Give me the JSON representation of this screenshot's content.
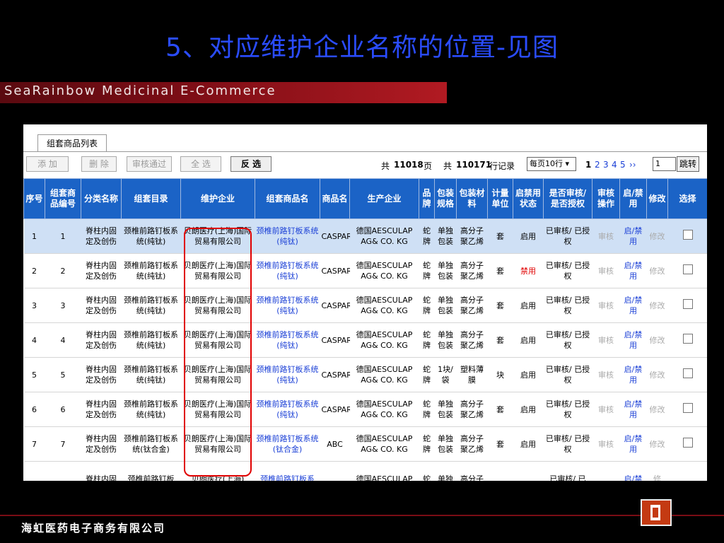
{
  "slide": {
    "title": "5、对应维护企业名称的位置-见图",
    "brand": "SeaRainbow Medicinal E-Commerce",
    "footer": "海虹医药电子商务有限公司"
  },
  "panel": {
    "tab": "组套商品列表",
    "toolbar": {
      "add": "添 加",
      "delete": "删 除",
      "approve": "审核通过",
      "select_all": "全 选",
      "invert": "反 选",
      "total_pages_prefix": "共",
      "total_pages": "11018",
      "pages_unit": "页",
      "total_rows_prefix": "共",
      "total_rows": "110171",
      "rows_unit": "行记录",
      "page_size": "每页10行",
      "pages": [
        "1",
        "2",
        "3",
        "4",
        "5"
      ],
      "next": "››",
      "page_input": "1",
      "jump": "跳转"
    },
    "columns": [
      "序号",
      "组套商品编号",
      "分类名称",
      "组套目录",
      "维护企业",
      "组套商品名",
      "商品名",
      "生产企业",
      "品牌",
      "包装规格",
      "包装材料",
      "计量单位",
      "启禁用状态",
      "是否审核/是否授权",
      "审核操作",
      "启/禁用",
      "修改",
      "选择"
    ],
    "rows": [
      [
        "1",
        "1",
        "脊柱内固定及创伤",
        "颈椎前路钉板系统(纯钛)",
        "贝朗医疗(上海)国际贸易有限公司",
        "颈椎前路钉板系统(纯钛)",
        "CASPAR",
        "德国AESCULAP AG& CO. KG",
        "蛇牌",
        "单独包装",
        "高分子聚乙烯",
        "套",
        "启用",
        "已审核/ 已授权",
        "审核",
        "启/禁用",
        "修改"
      ],
      [
        "2",
        "2",
        "脊柱内固定及创伤",
        "颈椎前路钉板系统(纯钛)",
        "贝朗医疗(上海)国际贸易有限公司",
        "颈椎前路钉板系统(纯钛)",
        "CASPAR",
        "德国AESCULAP AG& CO. KG",
        "蛇牌",
        "单独包装",
        "高分子聚乙烯",
        "套",
        "禁用",
        "已审核/ 已授权",
        "审核",
        "启/禁用",
        "修改"
      ],
      [
        "3",
        "3",
        "脊柱内固定及创伤",
        "颈椎前路钉板系统(纯钛)",
        "贝朗医疗(上海)国际贸易有限公司",
        "颈椎前路钉板系统(纯钛)",
        "CASPAR",
        "德国AESCULAP AG& CO. KG",
        "蛇牌",
        "单独包装",
        "高分子聚乙烯",
        "套",
        "启用",
        "已审核/ 已授权",
        "审核",
        "启/禁用",
        "修改"
      ],
      [
        "4",
        "4",
        "脊柱内固定及创伤",
        "颈椎前路钉板系统(纯钛)",
        "贝朗医疗(上海)国际贸易有限公司",
        "颈椎前路钉板系统(纯钛)",
        "CASPAR",
        "德国AESCULAP AG& CO. KG",
        "蛇牌",
        "单独包装",
        "高分子聚乙烯",
        "套",
        "启用",
        "已审核/ 已授权",
        "审核",
        "启/禁用",
        "修改"
      ],
      [
        "5",
        "5",
        "脊柱内固定及创伤",
        "颈椎前路钉板系统(纯钛)",
        "贝朗医疗(上海)国际贸易有限公司",
        "颈椎前路钉板系统(纯钛)",
        "CASPAR",
        "德国AESCULAP AG& CO. KG",
        "蛇牌",
        "1块/袋",
        "塑料薄膜",
        "块",
        "启用",
        "已审核/ 已授权",
        "审核",
        "启/禁用",
        "修改"
      ],
      [
        "6",
        "6",
        "脊柱内固定及创伤",
        "颈椎前路钉板系统(纯钛)",
        "贝朗医疗(上海)国际贸易有限公司",
        "颈椎前路钉板系统(纯钛)",
        "CASPAR",
        "德国AESCULAP AG& CO. KG",
        "蛇牌",
        "单独包装",
        "高分子聚乙烯",
        "套",
        "启用",
        "已审核/ 已授权",
        "审核",
        "启/禁用",
        "修改"
      ],
      [
        "7",
        "7",
        "脊柱内固定及创伤",
        "颈椎前路钉板系统(钛合金)",
        "贝朗医疗(上海)国际贸易有限公司",
        "颈椎前路钉板系统(钛合金)",
        "ABC",
        "德国AESCULAP AG& CO. KG",
        "蛇牌",
        "单独包装",
        "高分子聚乙烯",
        "套",
        "启用",
        "已审核/ 已授权",
        "审核",
        "启/禁用",
        "修改"
      ],
      [
        "",
        "",
        "脊柱内固",
        "颈椎前路钉板",
        "贝朗医疗(上海)",
        "颈椎前路钉板系",
        "",
        "德国AESCULAP",
        "蛇",
        "单独",
        "高分子",
        "",
        "",
        "已审核/ 已",
        "",
        "启/禁",
        "修"
      ]
    ]
  }
}
